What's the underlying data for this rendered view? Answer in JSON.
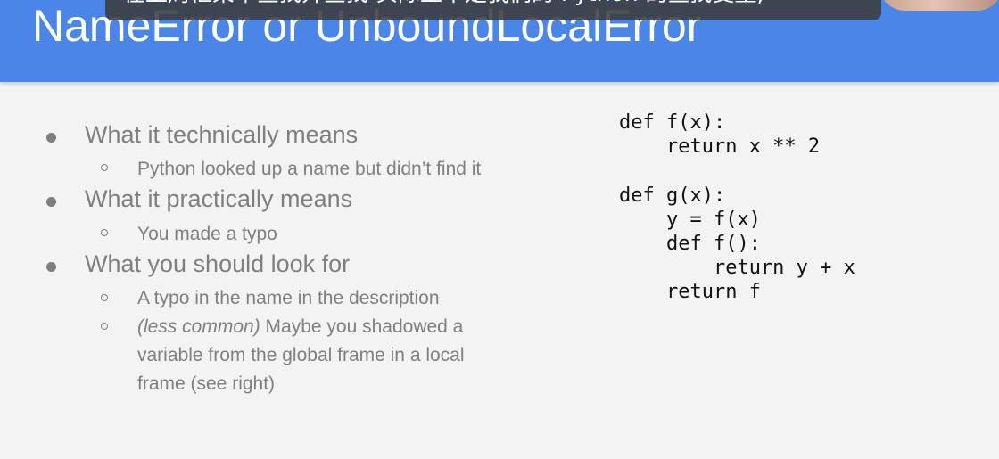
{
  "slide": {
    "title": "NameError or UnboundLocalError",
    "subtitle_overlay": "在上周框架中查找并查找 实际上不是我们的 Python 的查找变量,"
  },
  "bullets": [
    {
      "text": "What it technically means",
      "children": [
        "Python looked up a name but didn’t find it"
      ]
    },
    {
      "text": "What it practically means",
      "children": [
        "You made a typo"
      ]
    },
    {
      "text": "What you should look for",
      "children": [
        "A typo in the name in the description",
        {
          "italic": "(less common)",
          "line1": " Maybe you shadowed a",
          "line2": "variable from the global frame in a local",
          "line3": "frame (see right)"
        }
      ]
    }
  ],
  "code_example": "def f(x):\n    return x ** 2\n\ndef g(x):\n    y = f(x)\n    def f():\n        return y + x\n    return f",
  "colors": {
    "header": "#4a86e8",
    "background": "#f3f3f3",
    "bullet_text": "#7f7f7f",
    "code_text": "#111111"
  }
}
